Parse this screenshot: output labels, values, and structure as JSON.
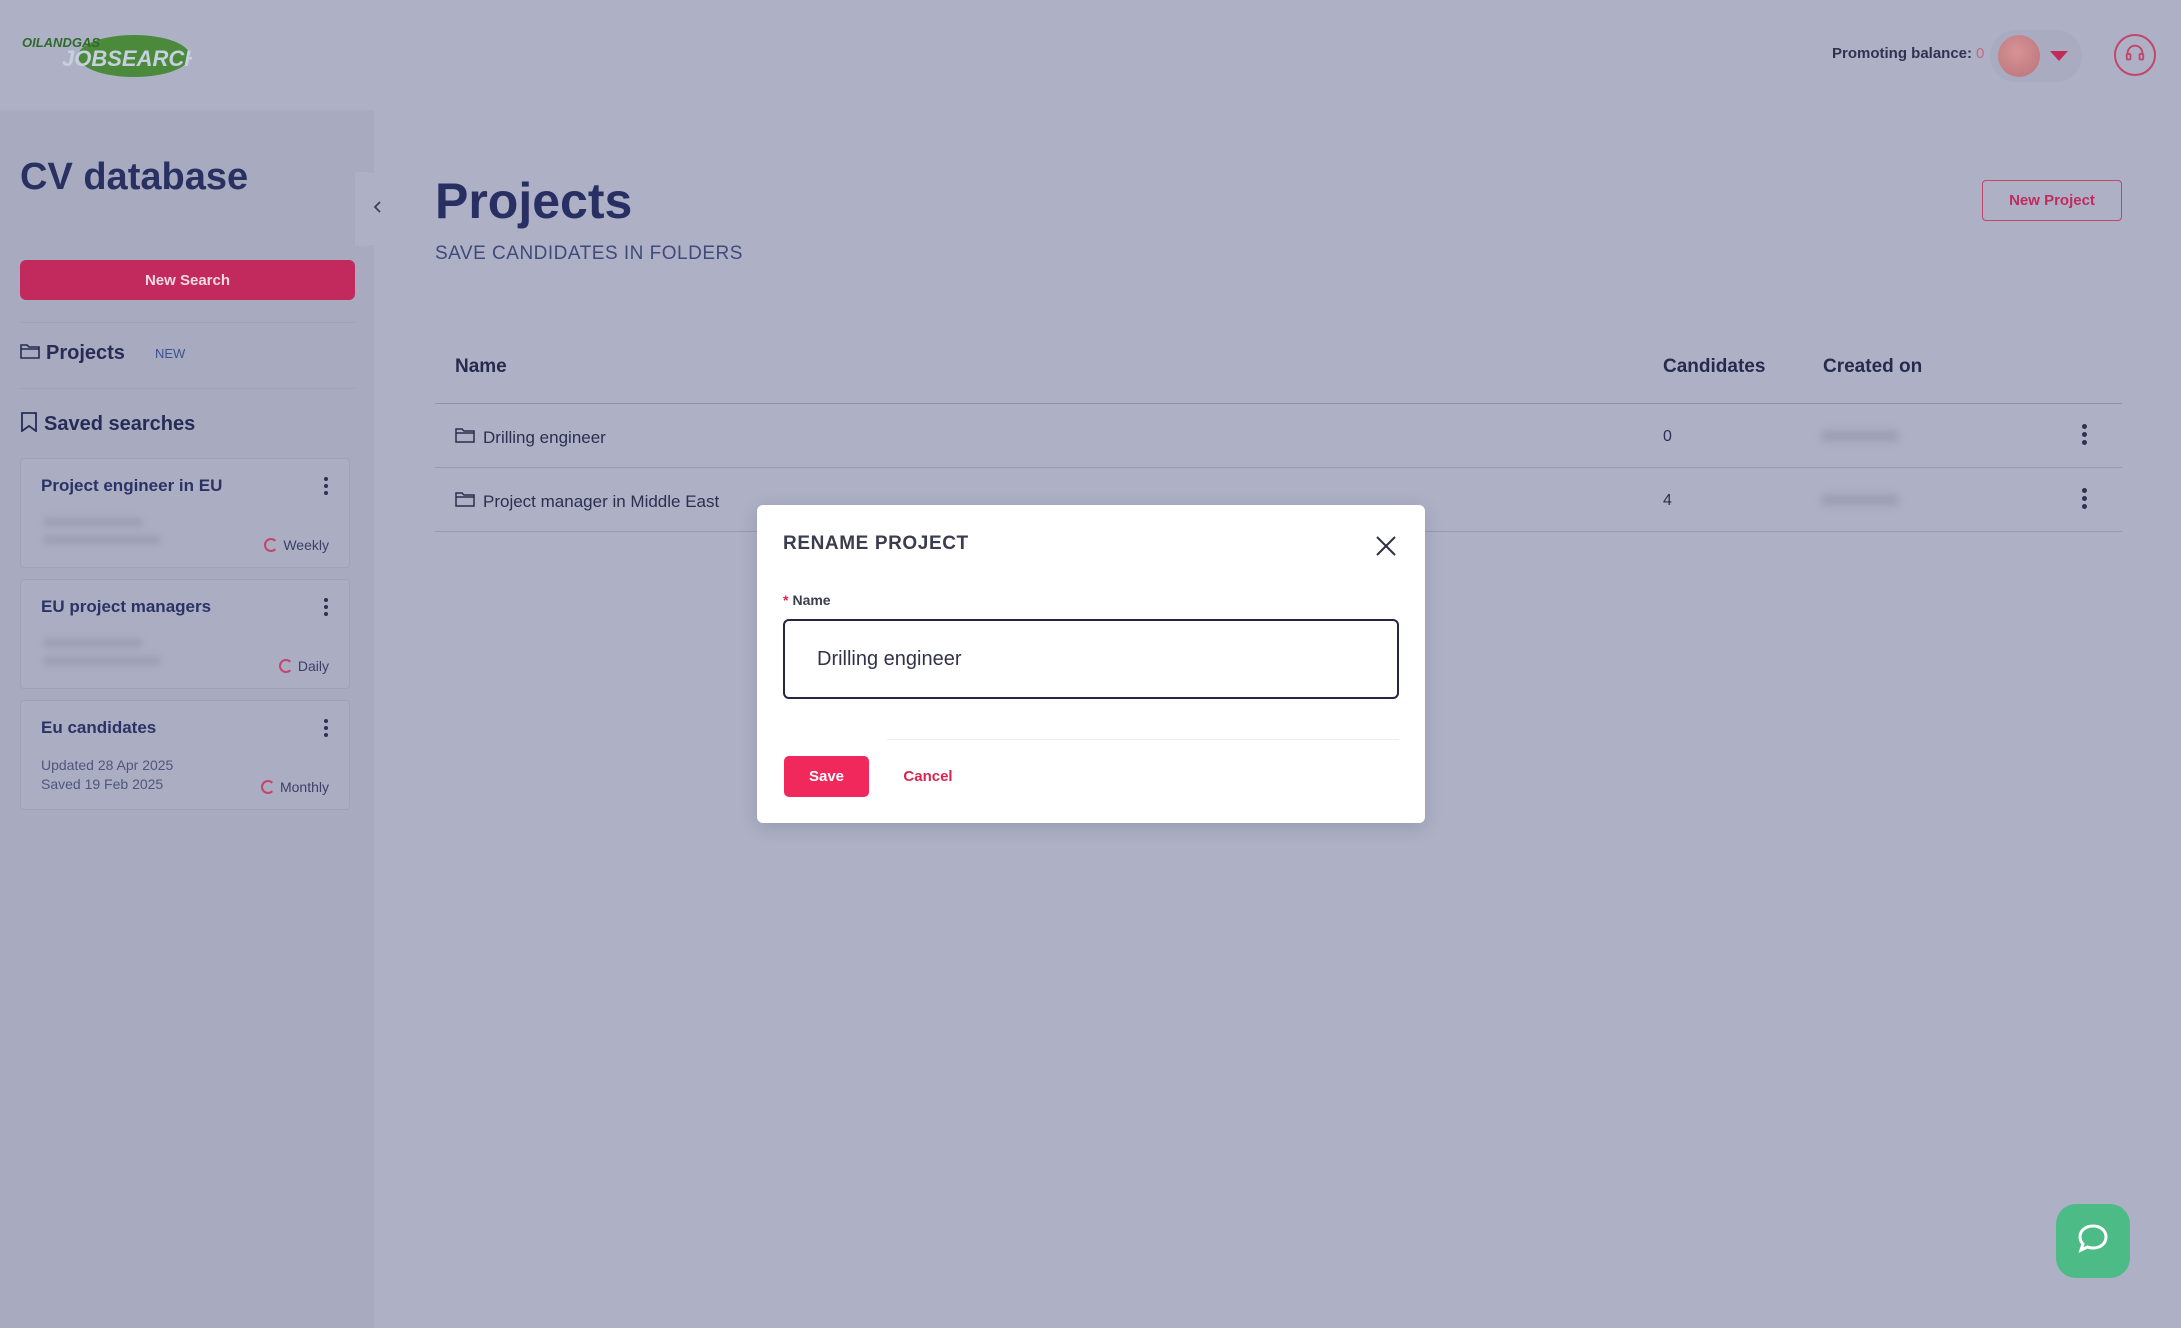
{
  "header": {
    "logo_text_top": "OILANDGAS",
    "logo_text_main": "JOBSEARCH",
    "promoting_label": "Promoting balance:",
    "promoting_value": "0"
  },
  "sidebar": {
    "title": "CV database",
    "new_search_label": "New Search",
    "projects_label": "Projects",
    "projects_badge": "NEW",
    "saved_searches_label": "Saved searches",
    "saved_searches": [
      {
        "title": "Project engineer in EU",
        "frequency": "Weekly"
      },
      {
        "title": "EU project managers",
        "frequency": "Daily"
      },
      {
        "title": "Eu candidates",
        "frequency": "Monthly",
        "updated_label": "Updated",
        "updated_value": "28 Apr 2025",
        "saved_label": "Saved",
        "saved_value": "19 Feb 2025"
      }
    ]
  },
  "main": {
    "title": "Projects",
    "subtitle": "SAVE CANDIDATES IN FOLDERS",
    "new_project_label": "New Project",
    "table": {
      "columns": [
        "Name",
        "Candidates",
        "Created on"
      ],
      "rows": [
        {
          "name": "Drilling engineer",
          "candidates": "0"
        },
        {
          "name": "Project manager in Middle East",
          "candidates": "4"
        }
      ]
    }
  },
  "modal": {
    "title": "RENAME PROJECT",
    "required_marker": "*",
    "field_label": "Name",
    "field_value": "Drilling engineer",
    "save_label": "Save",
    "cancel_label": "Cancel"
  },
  "colors": {
    "accent": "#f0285b",
    "brand_green": "#4dbb86",
    "overlay_bg": "#aeb1c6"
  },
  "icons": [
    "chevron-left-icon",
    "folder-icon",
    "bookmark-icon",
    "kebab-icon",
    "refresh-icon",
    "close-icon",
    "headset-icon",
    "chat-icon",
    "caret-down-icon"
  ]
}
